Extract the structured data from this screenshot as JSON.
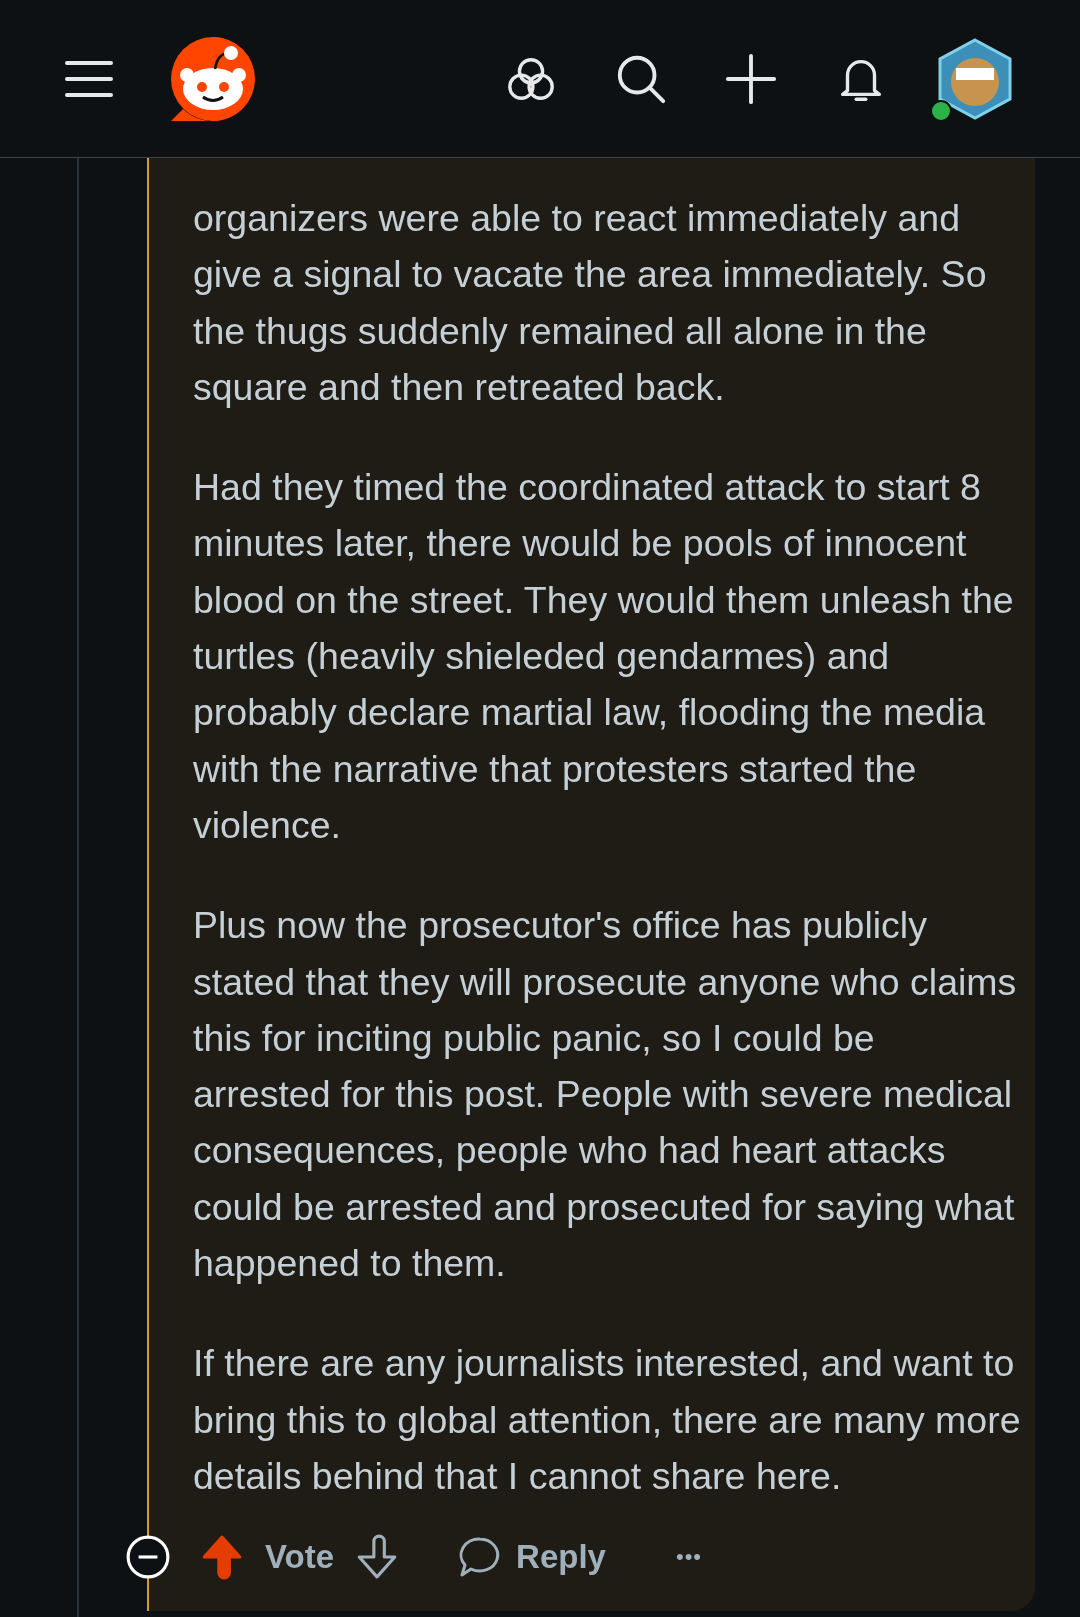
{
  "header": {
    "profile": {
      "online": true
    }
  },
  "comment": {
    "paragraphs": [
      "organizers were able to react immediately and give a signal to vacate the area immediately. So the thugs suddenly remained all alone in the square and then retreated back.",
      "Had they timed the coordinated attack to start 8 minutes later, there would be pools of innocent blood on the street. They would them unleash the turtles (heavily shieleded gendarmes) and probably declare martial law, flooding the media with the narrative that protesters started the violence.",
      "Plus now the prosecutor's office has publicly stated that they will prosecute anyone who claims this for inciting public panic, so I could be arrested for this post. People with severe medical consequences, people who had heart attacks could be arrested and prosecuted for saying what happened to them.",
      "If there are any journalists interested, and want to bring this to global attention, there are many more details behind that I cannot share here."
    ],
    "expanded": true,
    "vote": {
      "label": "Vote",
      "upvoted": true
    },
    "reply": "Reply",
    "more": "•••"
  }
}
